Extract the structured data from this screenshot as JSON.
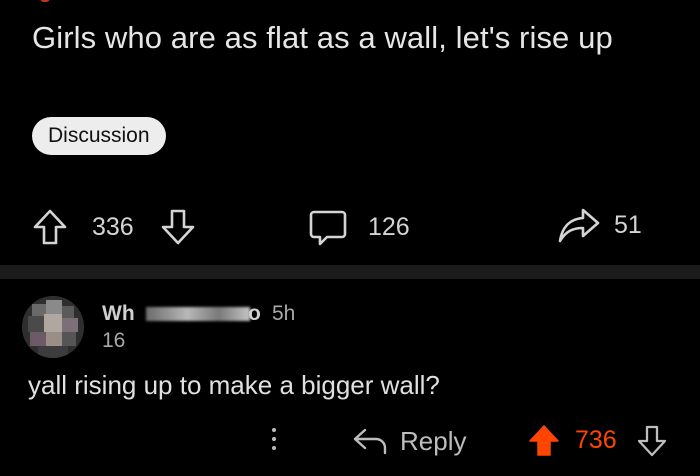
{
  "post": {
    "title": "Girls who are as flat as a wall, let's rise up",
    "flair": "Discussion",
    "upvotes": "336",
    "comments": "126",
    "shares": "51"
  },
  "icons": {
    "upvote": "arrow-up-outline-icon",
    "downvote": "arrow-down-outline-icon",
    "comment": "speech-bubble-icon",
    "share": "share-arrow-icon",
    "more": "vertical-ellipsis-icon",
    "reply": "reply-arrow-icon"
  },
  "comment": {
    "username_visible_start": "Wh",
    "username_visible_end": "o",
    "timestamp": "5h",
    "user_karma": "16",
    "body": "yall rising up to make a bigger wall?",
    "reply_label": "Reply",
    "score": "736",
    "upvoted": true
  },
  "colors": {
    "background": "#000000",
    "upvote_active": "#ff4500",
    "flair_bg": "#ededed",
    "divider": "#1b1b1b"
  }
}
